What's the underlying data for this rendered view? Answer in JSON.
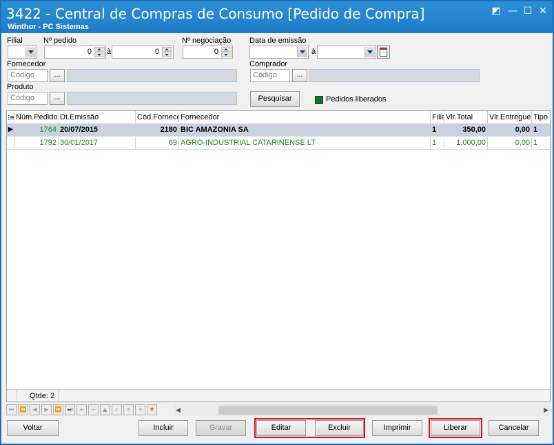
{
  "window": {
    "title": "3422 - Central de Compras de Consumo [Pedido de Compra]",
    "subtitle": "Winthor - PC Sistemas"
  },
  "filters": {
    "filial_label": "Filial",
    "pedido_label": "Nº pedido",
    "pedido_from": "0",
    "pedido_sep": "à",
    "pedido_to": "0",
    "negociacao_label": "Nº negociação",
    "negociacao_value": "0",
    "data_label": "Data de emissão",
    "data_sep": "à",
    "fornecedor_label": "Fornecedor",
    "fornecedor_placeholder": "Código",
    "comprador_label": "Comprador",
    "comprador_placeholder": "Código",
    "produto_label": "Produto",
    "produto_placeholder": "Código",
    "dots": "...",
    "pesquisar": "Pesquisar",
    "legend_label": "Pedidos liberados",
    "legend_color": "#0e7a0e"
  },
  "grid": {
    "columns": [
      "Núm.Pedido",
      "Dt.Emissão",
      "Cód.Fornecedor",
      "Fornecedor",
      "Filial",
      "Vlr.Total",
      "Vlr.Entregue",
      "Tipo"
    ],
    "rows": [
      [
        "1764",
        "20/07/2015",
        "2180",
        "BIC AMAZONIA SA",
        "1",
        "350,00",
        "0,00",
        "1"
      ],
      [
        "1792",
        "30/01/2017",
        "69",
        "AGRO-INDUSTRIAL CATARINENSE LT",
        "1",
        "1.000,00",
        "0,00",
        "1"
      ]
    ],
    "count_label": "Qtde: 2"
  },
  "buttons": {
    "voltar": "Voltar",
    "incluir": "Incluir",
    "gravar": "Gravar",
    "editar": "Editar",
    "excluir": "Excluir",
    "imprimir": "Imprimir",
    "liberar": "Liberar",
    "cancelar": "Cancelar"
  },
  "highlight_color": "#e0101a"
}
